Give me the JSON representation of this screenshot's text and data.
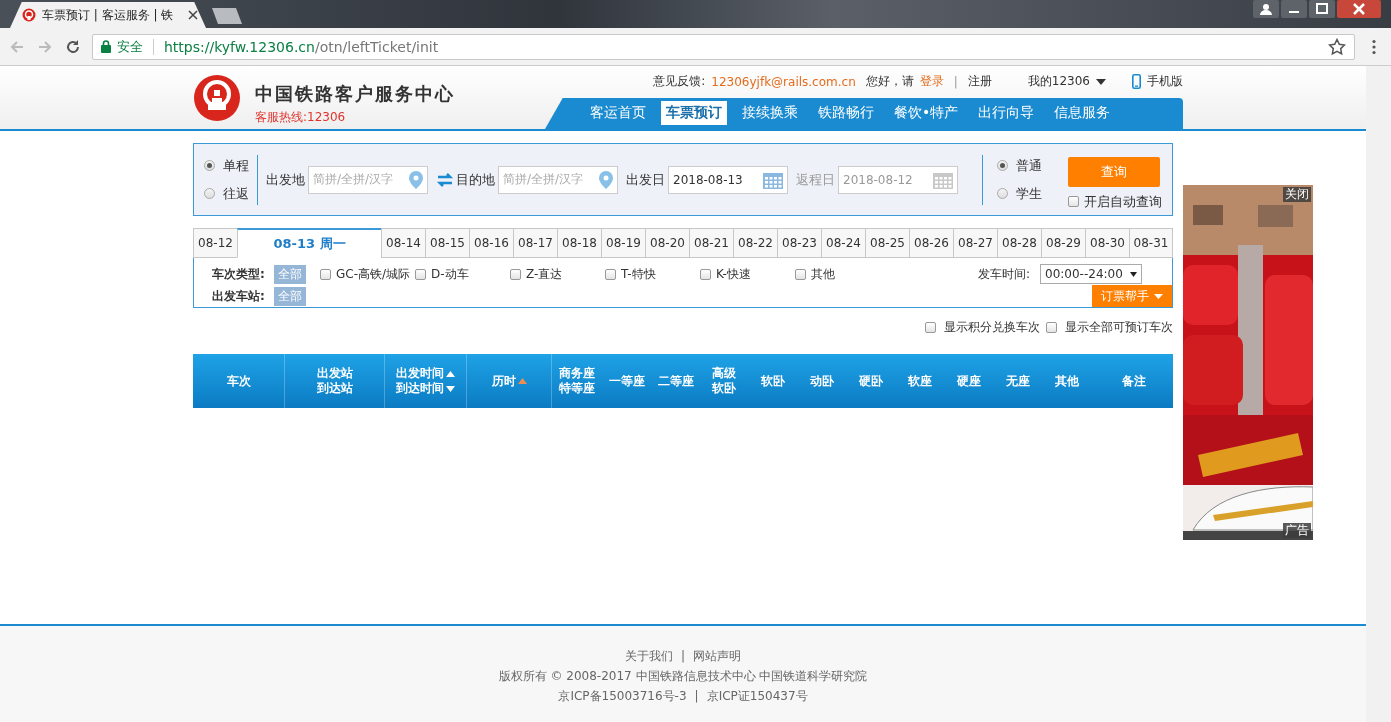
{
  "browser": {
    "tab_title": "车票预订 | 客运服务 | 铁",
    "secure_label": "安全",
    "url_host": "https://kyfw.12306.cn",
    "url_path": "/otn/leftTicket/init"
  },
  "header": {
    "site_name": "中国铁路客户服务中心",
    "hotline": "客服热线:12306",
    "feedback_label": "意见反馈:",
    "feedback_email": "12306yjfk@rails.com.cn",
    "greeting": "您好，请",
    "login": "登录",
    "separator": "|",
    "register": "注册",
    "my_account": "我的12306",
    "mobile": "手机版",
    "nav": [
      {
        "label": "客运首页",
        "selected": false
      },
      {
        "label": "车票预订",
        "selected": true
      },
      {
        "label": "接续换乘",
        "selected": false
      },
      {
        "label": "铁路畅行",
        "selected": false
      },
      {
        "label": "餐饮•特产",
        "selected": false
      },
      {
        "label": "出行向导",
        "selected": false
      },
      {
        "label": "信息服务",
        "selected": false
      }
    ]
  },
  "search": {
    "trip_types": [
      {
        "label": "单程",
        "selected": true
      },
      {
        "label": "往返",
        "selected": false
      }
    ],
    "from_label": "出发地",
    "from_placeholder": "简拼/全拼/汉字",
    "to_label": "目的地",
    "to_placeholder": "简拼/全拼/汉字",
    "depart_label": "出发日",
    "depart_value": "2018-08-13",
    "return_label": "返程日",
    "return_value": "2018-08-12",
    "return_disabled": true,
    "passenger_types": [
      {
        "label": "普通",
        "selected": true
      },
      {
        "label": "学生",
        "selected": false
      }
    ],
    "query_button": "查询",
    "auto_query": {
      "label": "开启自动查询",
      "checked": false
    }
  },
  "dates": [
    {
      "label": "08-12",
      "selected": false
    },
    {
      "label": "08-13 周一",
      "selected": true
    },
    {
      "label": "08-14",
      "selected": false
    },
    {
      "label": "08-15",
      "selected": false
    },
    {
      "label": "08-16",
      "selected": false
    },
    {
      "label": "08-17",
      "selected": false
    },
    {
      "label": "08-18",
      "selected": false
    },
    {
      "label": "08-19",
      "selected": false
    },
    {
      "label": "08-20",
      "selected": false
    },
    {
      "label": "08-21",
      "selected": false
    },
    {
      "label": "08-22",
      "selected": false
    },
    {
      "label": "08-23",
      "selected": false
    },
    {
      "label": "08-24",
      "selected": false
    },
    {
      "label": "08-25",
      "selected": false
    },
    {
      "label": "08-26",
      "selected": false
    },
    {
      "label": "08-27",
      "selected": false
    },
    {
      "label": "08-28",
      "selected": false
    },
    {
      "label": "08-29",
      "selected": false
    },
    {
      "label": "08-30",
      "selected": false
    },
    {
      "label": "08-31",
      "selected": false
    }
  ],
  "filters": {
    "train_type_label": "车次类型:",
    "all_button": "全部",
    "train_types": [
      {
        "label": "GC-高铁/城际",
        "checked": false
      },
      {
        "label": "D-动车",
        "checked": false
      },
      {
        "label": "Z-直达",
        "checked": false
      },
      {
        "label": "T-特快",
        "checked": false
      },
      {
        "label": "K-快速",
        "checked": false
      },
      {
        "label": "其他",
        "checked": false
      }
    ],
    "depart_time_label": "发车时间:",
    "depart_time_value": "00:00--24:00",
    "station_label": "出发车站:",
    "station_all": "全部",
    "helper_button": "订票帮手"
  },
  "options": [
    {
      "label": "显示积分兑换车次",
      "checked": false
    },
    {
      "label": "显示全部可预订车次",
      "checked": false
    }
  ],
  "table": {
    "columns": [
      {
        "lines": [
          "车次"
        ]
      },
      {
        "lines": [
          "出发站",
          "到达站"
        ]
      },
      {
        "lines": [
          "出发时间",
          "到达时间"
        ],
        "sort_up": true,
        "sort_down": true,
        "sort_active": false
      },
      {
        "lines": [
          "历时"
        ],
        "sort_up": true,
        "sort_down": false,
        "sort_active": true
      },
      {
        "lines": [
          "商务座",
          "特等座"
        ]
      },
      {
        "lines": [
          "一等座"
        ]
      },
      {
        "lines": [
          "二等座"
        ]
      },
      {
        "lines": [
          "高级",
          "软卧"
        ]
      },
      {
        "lines": [
          "软卧"
        ]
      },
      {
        "lines": [
          "动卧"
        ]
      },
      {
        "lines": [
          "硬卧"
        ]
      },
      {
        "lines": [
          "软座"
        ]
      },
      {
        "lines": [
          "硬座"
        ]
      },
      {
        "lines": [
          "无座"
        ]
      },
      {
        "lines": [
          "其他"
        ]
      },
      {
        "lines": [
          "备注"
        ]
      }
    ]
  },
  "ad": {
    "kind": "picture",
    "close_label": "关闭",
    "ad_label": "广告"
  },
  "footer": {
    "links": [
      "关于我们",
      "网站声明"
    ],
    "separator": "|",
    "copyright": "版权所有 © 2008-2017 中国铁路信息技术中心 中国铁道科学研究院",
    "icp": "京ICP备15003716号-3",
    "icp_separator": "|",
    "icp2": "京ICP证150437号"
  }
}
